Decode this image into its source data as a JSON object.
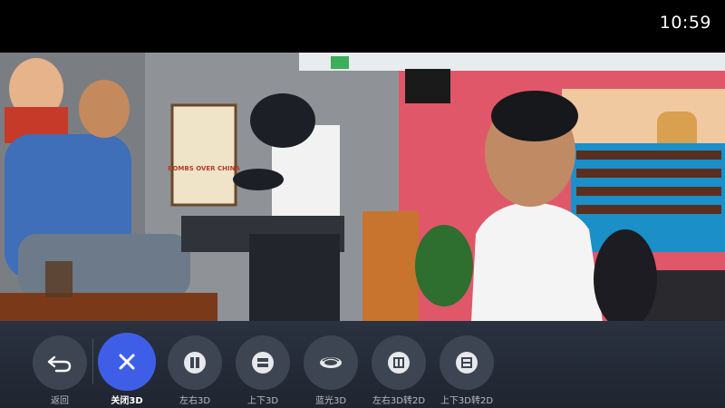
{
  "status_bar": {
    "time": "10:59"
  },
  "video_frame": {
    "poster_text": "BOMBS OVER CHINA"
  },
  "menu": {
    "items": [
      {
        "label": "返回",
        "icon": "back-arrow-icon",
        "active": false
      },
      {
        "label": "关闭3D",
        "icon": "close-icon",
        "active": true
      },
      {
        "label": "左右3D",
        "icon": "side-by-side-icon",
        "active": false
      },
      {
        "label": "上下3D",
        "icon": "top-bottom-icon",
        "active": false
      },
      {
        "label": "蓝光3D",
        "icon": "bluray-disc-icon",
        "active": false
      },
      {
        "label": "左右3D转2D",
        "icon": "side-by-side-to-2d-icon",
        "active": false
      },
      {
        "label": "上下3D转2D",
        "icon": "top-bottom-to-2d-icon",
        "active": false
      }
    ]
  },
  "colors": {
    "accent": "#3f5ee8",
    "button_bg": "#3d4452",
    "bar_bg": "#262d39"
  }
}
